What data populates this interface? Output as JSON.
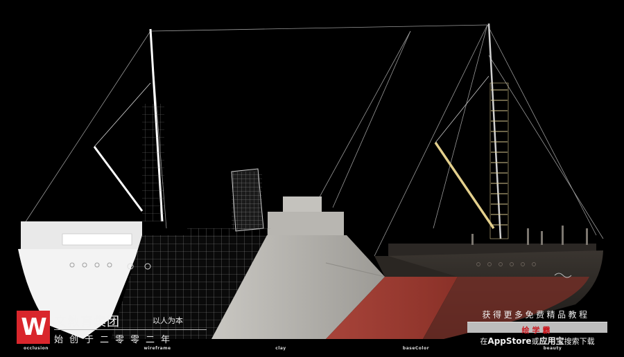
{
  "brand": {
    "logo_letter": "W",
    "name": "文教育集团",
    "slogan": "以人为本",
    "founded": "始创于二零零二年"
  },
  "promo": {
    "line1": "获得更多免费精品教程",
    "app_name": "绘学霸",
    "line3_prefix": "在",
    "line3_store": "AppStore",
    "line3_mid": "或",
    "line3_store2": "应用宝",
    "line3_suffix": "搜索下载"
  },
  "passes": {
    "occlusion": "occlusion",
    "wireframe": "wireframe",
    "clay": "clay",
    "basecolor": "baseColor",
    "beauty": "beauty"
  },
  "colors": {
    "background": "#000000",
    "brand_red": "#d9262c",
    "basecolor_red": "#9b3a30",
    "beauty_hull": "#2a2622",
    "clay": "#b5b3ae",
    "occlusion": "#f2f2f2"
  }
}
